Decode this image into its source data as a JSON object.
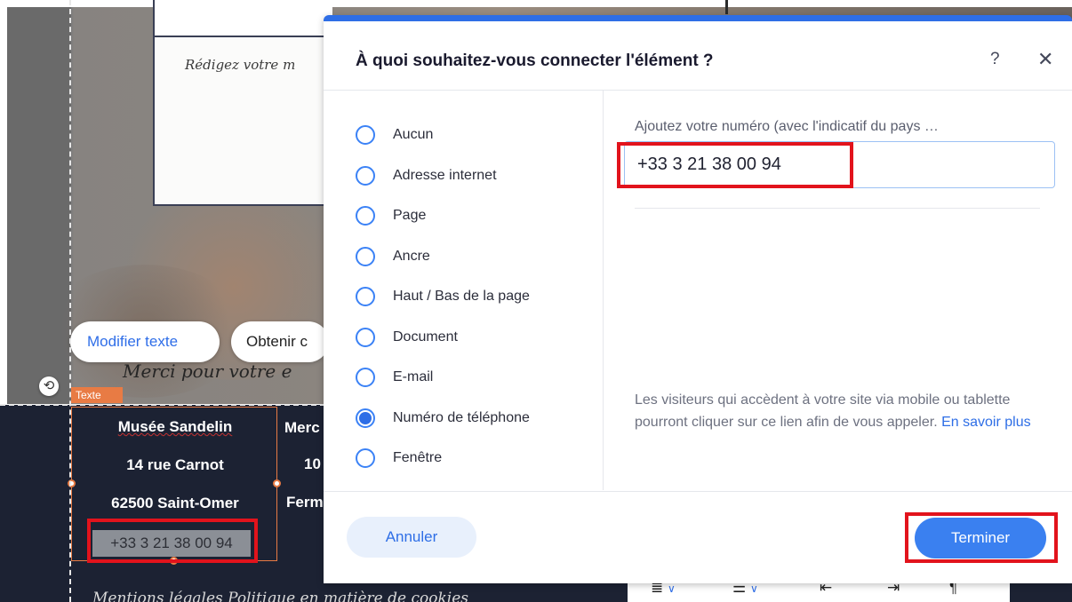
{
  "background": {
    "text_card_placeholder": "Rédigez votre m",
    "action_pills": {
      "edit_text": "Modifier texte",
      "obtain": "Obtenir c"
    },
    "merci_text": "Merci pour votre e",
    "selected_element_tag": "Texte",
    "footer": {
      "venue_name": "Musée Sandelin",
      "street": "14 rue Carnot",
      "city": "62500 Saint-Omer",
      "phone": "+33 3 21 38 00 94",
      "col2_line1": "Merc",
      "col2_line2": "10",
      "col2_line3": "Ferm",
      "links_text": "Mentions légales     Politique en matière de cookies"
    },
    "colors": {
      "footer_bg": "#1c2233",
      "selection": "#e87b44",
      "highlight": "#e2131c"
    }
  },
  "dialog": {
    "title": "À quoi souhaitez-vous connecter l'élément ?",
    "help_icon": "?",
    "close_icon": "✕",
    "link_types": [
      {
        "label": "Aucun",
        "selected": false
      },
      {
        "label": "Adresse internet",
        "selected": false
      },
      {
        "label": "Page",
        "selected": false
      },
      {
        "label": "Ancre",
        "selected": false
      },
      {
        "label": "Haut / Bas de la page",
        "selected": false
      },
      {
        "label": "Document",
        "selected": false
      },
      {
        "label": "E-mail",
        "selected": false
      },
      {
        "label": "Numéro de téléphone",
        "selected": true
      },
      {
        "label": "Fenêtre",
        "selected": false
      }
    ],
    "phone_field": {
      "label": "Ajoutez votre numéro (avec l'indicatif du pays …",
      "value": "+33 3 21 38 00 94"
    },
    "help_text": "Les visiteurs qui accèdent à votre site via mobile ou tablette pourront cliquer sur ce lien afin de vous appeler.",
    "help_link": "En savoir plus",
    "cancel_label": "Annuler",
    "done_label": "Terminer",
    "accent_color": "#2e6ee6"
  }
}
